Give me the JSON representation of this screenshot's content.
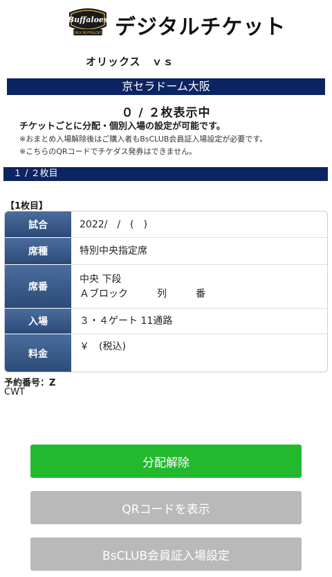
{
  "header": {
    "logo_text": "Buffaloes",
    "logo_sub": "ORIX BUFFALOES",
    "title": "デジタルチケット"
  },
  "matchup": "オリックス　ｖｓ",
  "venue": "京セラドーム大阪",
  "display_count": "０ / ２枚表示中",
  "notes": {
    "main": "チケットごとに分配・個別入場の設定が可能です。",
    "line1": "※おまとめ入場解除後はご購入者もBsCLUB会員証入場設定が必要です。",
    "line2": "※こちらのQRコードでチケダス発券はできません。"
  },
  "ticket_bar": "１ / ２枚目",
  "ticket_heading": "【1枚目】",
  "table": {
    "rows": [
      {
        "label": "試合",
        "value": "2022/　/　(　)"
      },
      {
        "label": "席種",
        "value": "特別中央指定席"
      },
      {
        "label": "席番",
        "value": "中央 下段",
        "value2": "Ａブロック　　　列　　　番"
      },
      {
        "label": "入場",
        "value": "３・４ゲート 11通路"
      },
      {
        "label": "料金",
        "value": "￥　(税込)"
      }
    ]
  },
  "reservation": "予約番号：Z",
  "reservation_sub": "CWT",
  "buttons": {
    "release": "分配解除",
    "show_qr": "QRコードを表示",
    "bsclub": "BsCLUB会員証入場設定"
  },
  "colors": {
    "navy": "#0c2461",
    "label_blue": "#3a5b8c",
    "green": "#22b92f",
    "gray": "#b9b9b9"
  }
}
